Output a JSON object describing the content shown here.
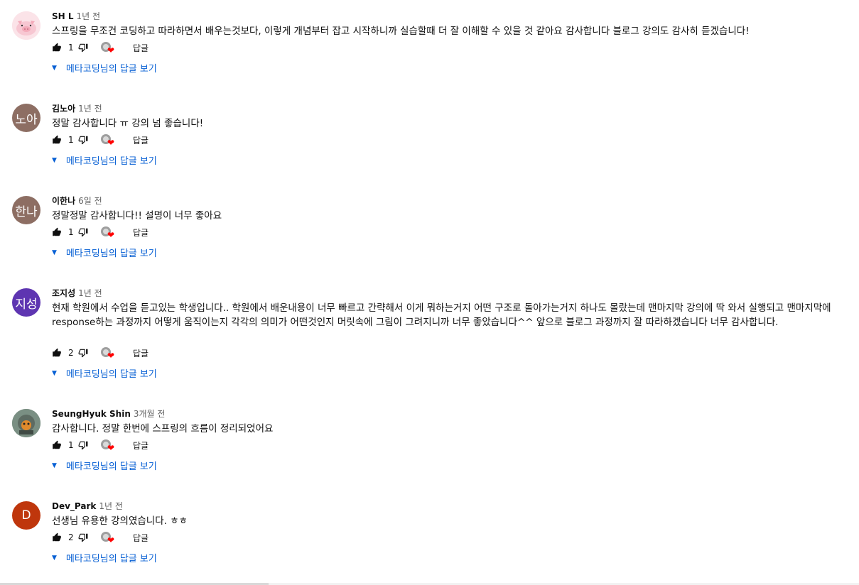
{
  "comments": [
    {
      "author": "SH L",
      "time": "1년 전",
      "avatar_type": "pig-image",
      "avatar_color": "#f7d7df",
      "text": "스프링을 무조건 코딩하고 따라하면서 배우는것보다, 이렇게 개념부터 잡고 시작하니까 실습할때 더 잘 이해할 수 있을 것 같아요 감사합니다 블로그 강의도 감사히 듣겠습니다!",
      "likes": "1",
      "reply_label": "답글",
      "replies_label": "메타코딩님의 답글 보기"
    },
    {
      "author": "김노아",
      "time": "1년 전",
      "avatar_type": "initials",
      "avatar_text": "노아",
      "avatar_color": "#8d6e63",
      "text": "정말 감사합니다 ㅠ 강의 넘 좋습니다!",
      "likes": "1",
      "reply_label": "답글",
      "replies_label": "메타코딩님의 답글 보기"
    },
    {
      "author": "이한나",
      "time": "6일 전",
      "avatar_type": "initials",
      "avatar_text": "한나",
      "avatar_color": "#8d6e63",
      "text": "정말정말 감사합니다!! 설명이 너무 좋아요",
      "likes": "1",
      "reply_label": "답글",
      "replies_label": "메타코딩님의 답글 보기"
    },
    {
      "author": "조지성",
      "time": "1년 전",
      "avatar_type": "initials",
      "avatar_text": "지성",
      "avatar_color": "#5e35b1",
      "text": "현재 학원에서 수업을 듣고있는 학생입니다.. 학원에서 배운내용이 너무 빠르고 간략해서 이게 뭐하는거지 어떤 구조로 돌아가는거지 하나도 몰랐는데 맨마지막 강의에 딱 와서 실행되고 맨마지막에 response하는 과정까지 어떻게 움직이는지 각각의 의미가 어떤것인지 머릿속에 그림이 그려지니까 너무 좋았습니다^^ 앞으로 블로그 과정까지 잘 따라하겠습니다 너무 감사합니다.",
      "likes": "2",
      "reply_label": "답글",
      "replies_label": "메타코딩님의 답글 보기"
    },
    {
      "author": "SeungHyuk Shin",
      "time": "3개월 전",
      "avatar_type": "photo",
      "avatar_color": "#607d6b",
      "text": "감사합니다. 정말 한번에 스프링의 흐름이 정리되었어요",
      "likes": "1",
      "reply_label": "답글",
      "replies_label": "메타코딩님의 답글 보기"
    },
    {
      "author": "Dev_Park",
      "time": "1년 전",
      "avatar_type": "initials",
      "avatar_text": "D",
      "avatar_color": "#bf360c",
      "text": "선생님 유용한 강의였습니다. ㅎㅎ",
      "likes": "2",
      "reply_label": "답글",
      "replies_label": "메타코딩님의 답글 보기"
    }
  ],
  "icons": {
    "like": "thumb-up-icon",
    "dislike": "thumb-down-icon",
    "heart": "heart-icon",
    "caret": "caret-down-icon"
  },
  "colors": {
    "link": "#065fd4",
    "heart": "#ff0000",
    "secondary_text": "#606060"
  }
}
